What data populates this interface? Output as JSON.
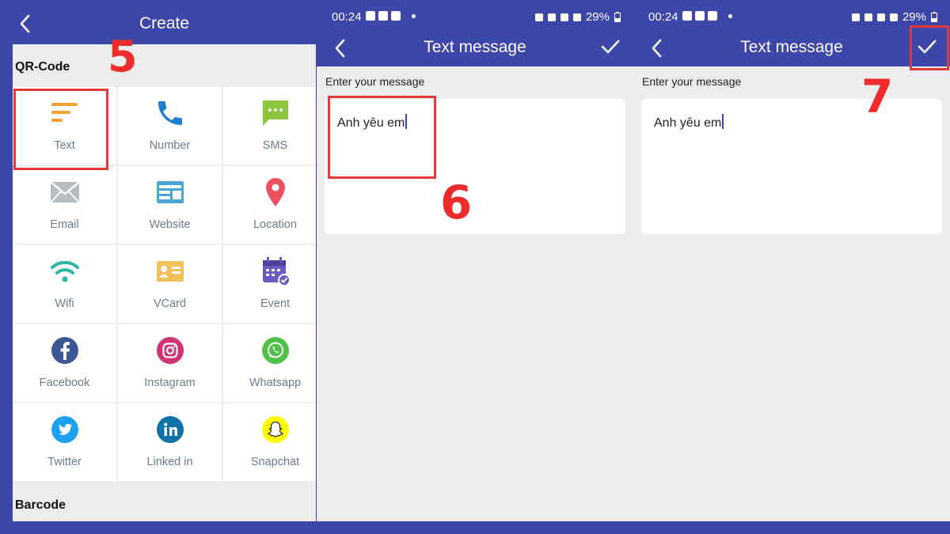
{
  "create": {
    "title": "Create",
    "sections": {
      "qr": "QR-Code",
      "barcode": "Barcode"
    },
    "items": [
      {
        "label": "Text",
        "icon": "text-lines-icon"
      },
      {
        "label": "Number",
        "icon": "phone-icon"
      },
      {
        "label": "SMS",
        "icon": "sms-icon"
      },
      {
        "label": "Email",
        "icon": "email-icon"
      },
      {
        "label": "Website",
        "icon": "website-icon"
      },
      {
        "label": "Location",
        "icon": "location-pin-icon"
      },
      {
        "label": "Wifi",
        "icon": "wifi-icon"
      },
      {
        "label": "VCard",
        "icon": "vcard-icon"
      },
      {
        "label": "Event",
        "icon": "calendar-event-icon"
      },
      {
        "label": "Facebook",
        "icon": "facebook-icon"
      },
      {
        "label": "Instagram",
        "icon": "instagram-icon"
      },
      {
        "label": "Whatsapp",
        "icon": "whatsapp-icon"
      },
      {
        "label": "Twitter",
        "icon": "twitter-icon"
      },
      {
        "label": "Linked in",
        "icon": "linkedin-icon"
      },
      {
        "label": "Snapchat",
        "icon": "snapchat-icon"
      }
    ]
  },
  "status_bar": {
    "time": "00:24",
    "battery": "29%"
  },
  "text_screen": {
    "title": "Text message",
    "field_label": "Enter your message",
    "message": "Anh yêu em"
  },
  "steps": {
    "s5": "5",
    "s6": "6",
    "s7": "7"
  },
  "colors": {
    "header": "#3d47a9",
    "highlight": "#e53935",
    "step_number": "#ef2b2b"
  }
}
